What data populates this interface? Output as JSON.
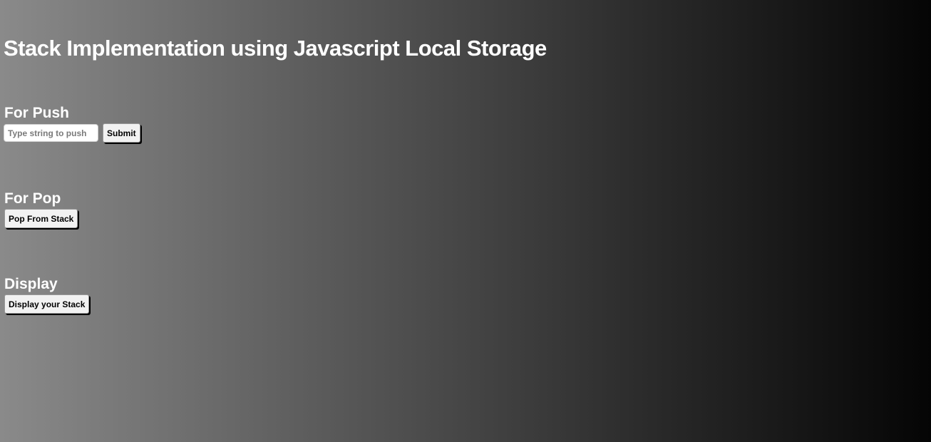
{
  "page": {
    "title": "Stack Implementation using Javascript Local Storage"
  },
  "push_section": {
    "heading": "For Push",
    "input_placeholder": "Type string to push",
    "input_value": "",
    "submit_label": "Submit"
  },
  "pop_section": {
    "heading": "For Pop",
    "button_label": "Pop From Stack"
  },
  "display_section": {
    "heading": "Display",
    "button_label": "Display your Stack"
  },
  "colors": {
    "background_gradient_start": "#8a8a8a",
    "background_gradient_end": "#050505",
    "text": "#ffffff",
    "button_bg": "#f2f2f2"
  }
}
